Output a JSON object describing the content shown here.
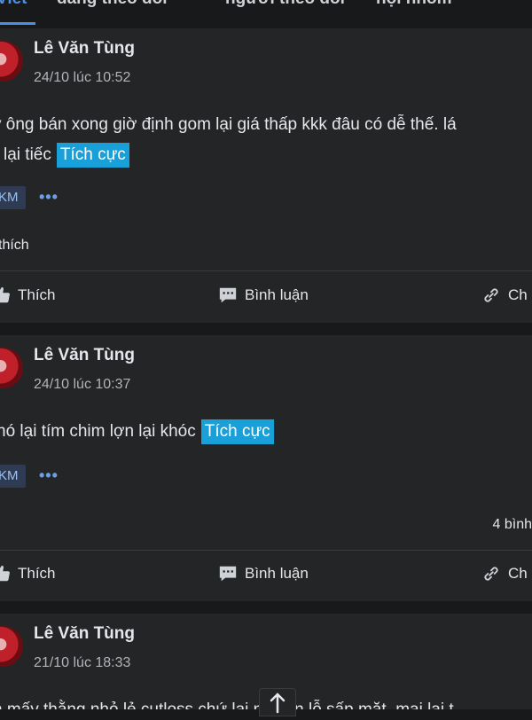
{
  "tabs": [
    {
      "label": "Viết"
    },
    {
      "label": "đang theo dõi"
    },
    {
      "label": "người theo dõi"
    },
    {
      "label": "hội nhóm"
    }
  ],
  "posts": [
    {
      "author": "Lê Văn Tùng",
      "time": "24/10 lúc 10:52",
      "line1": "y ông bán xong giờ định gom lại giá thấp kkk đâu có dễ thế. lá",
      "line2": "lại tiếc",
      "tag": "Tích cực",
      "badge": "KM",
      "likes": "thích",
      "actions": {
        "like": "Thích",
        "comment": "Bình luận",
        "share": "Ch"
      }
    },
    {
      "author": "Lê Văn Tùng",
      "time": "24/10 lúc 10:37",
      "line1": "nó lại tím chim lợn lại khóc",
      "tag": "Tích cực",
      "badge": "KM",
      "comments": "4 bình",
      "actions": {
        "like": "Thích",
        "comment": "Bình luận",
        "share": "Ch"
      }
    },
    {
      "author": "Lê Văn Tùng",
      "time": "21/10 lúc 18:33",
      "line1": "n mấy thằng nhỏ lẻ cutloss chứ lại nó còn lỗ sấp mặt, mai lại t"
    }
  ],
  "icons": {
    "like": "thumbs-up-icon",
    "comment": "comment-icon",
    "share": "share-icon",
    "more": "more-dots-icon",
    "scroll": "arrow-up-icon"
  },
  "colors": {
    "tag": "#1aa0d8",
    "accent": "#4a8fe8",
    "card": "#242526",
    "background": "#18191a"
  }
}
